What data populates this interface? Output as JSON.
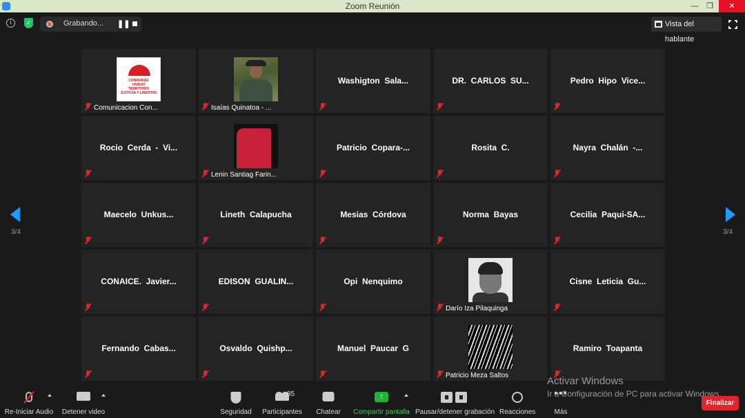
{
  "window": {
    "title": "Zoom Reunión"
  },
  "topbar": {
    "recording_label": "Grabando...",
    "speaker_view_label": "Vista del hablante"
  },
  "navigation": {
    "page_left": "3/4",
    "page_right": "3/4"
  },
  "participants": [
    {
      "name": "",
      "label": "Comunicacion Con...",
      "photo": "logo"
    },
    {
      "name": "",
      "label": "Isaías Quinatoa - ...",
      "photo": "man"
    },
    {
      "name": "Washigton  Sala...",
      "label": ""
    },
    {
      "name": "DR.  CARLOS  SU...",
      "label": ""
    },
    {
      "name": "Pedro  Hipo  Vice...",
      "label": ""
    },
    {
      "name": "Rocio  Cerda  -  Vi...",
      "label": ""
    },
    {
      "name": "",
      "label": "Lenin Santiag Farin...",
      "photo": "red"
    },
    {
      "name": "Patricio  Copara-...",
      "label": ""
    },
    {
      "name": "Rosita  C.",
      "label": ""
    },
    {
      "name": "Nayra  Chalán  -...",
      "label": ""
    },
    {
      "name": "Maecelo  Unkus...",
      "label": ""
    },
    {
      "name": "Lineth  Calapucha",
      "label": ""
    },
    {
      "name": "Mesias  Córdova",
      "label": ""
    },
    {
      "name": "Norma  Bayas",
      "label": ""
    },
    {
      "name": "Cecilia  Paqui-SA...",
      "label": ""
    },
    {
      "name": "CONAICE.  Javier...",
      "label": ""
    },
    {
      "name": "EDISON  GUALIN...",
      "label": ""
    },
    {
      "name": "Opi  Nenquimo",
      "label": ""
    },
    {
      "name": "",
      "label": "Darío Iza Pilaquinga",
      "photo": "face"
    },
    {
      "name": "Cisne  Leticia  Gu...",
      "label": ""
    },
    {
      "name": "Fernando  Cabas...",
      "label": ""
    },
    {
      "name": "Osvaldo  Quishp...",
      "label": ""
    },
    {
      "name": "Manuel  Paucar  G",
      "label": ""
    },
    {
      "name": "",
      "label": "Patricio Meza Saltos",
      "photo": "bw"
    },
    {
      "name": "Ramiro  Toapanta",
      "label": ""
    }
  ],
  "logo_text": "CONFENIAE\nUNIDAD\nTERRITORIO\nJUSTICIA Y LIBERTAD",
  "watermark": {
    "line1": "Activar Windows",
    "line2": "Ir a Configuración de PC para activar Windows."
  },
  "toolbar": {
    "audio": "Re-Iniciar Audio",
    "video": "Detener video",
    "security": "Seguridad",
    "participants": "Participantes",
    "participants_count": "85",
    "chat": "Chatear",
    "share": "Compartir pantalla",
    "recording": "Pausar/detener grabación",
    "reactions": "Reacciones",
    "more": "Más",
    "end": "Finalizar"
  },
  "colors": {
    "accent": "#1f9bff",
    "danger": "#e0252b",
    "share": "#1fb33a"
  }
}
